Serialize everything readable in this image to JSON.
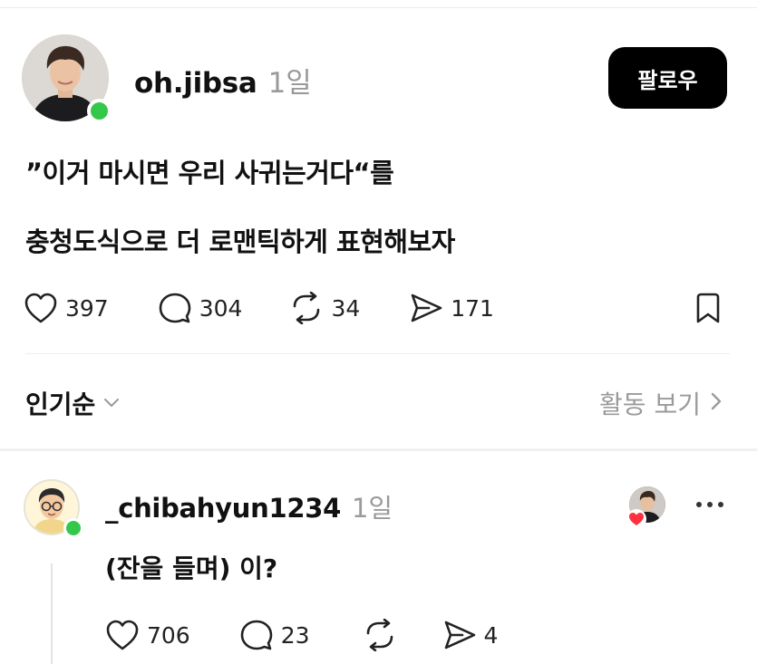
{
  "post": {
    "author": "oh.jibsa",
    "time": "1일",
    "follow_label": "팔로우",
    "lines": [
      "”이거 마시면 우리 사귀는거다“를",
      "충청도식으로 더 로맨틱하게 표현해보자"
    ],
    "stats": {
      "likes": "397",
      "comments": "304",
      "reposts": "34",
      "shares": "171"
    }
  },
  "sort": {
    "label": "인기순",
    "activity_label": "활동 보기"
  },
  "comment": {
    "author": "_chibahyun1234",
    "time": "1일",
    "text": "(잔을 들며) 이?",
    "stats": {
      "likes": "706",
      "comments": "23",
      "shares": "4"
    }
  },
  "colors": {
    "accent": "#000000",
    "online": "#34c84a",
    "muted": "#9a9a9a",
    "heart": "#ff3040"
  },
  "icons": [
    "heart-icon",
    "comment-icon",
    "repost-icon",
    "share-icon",
    "bookmark-icon",
    "chevron-down-icon",
    "chevron-right-icon",
    "more-icon"
  ]
}
